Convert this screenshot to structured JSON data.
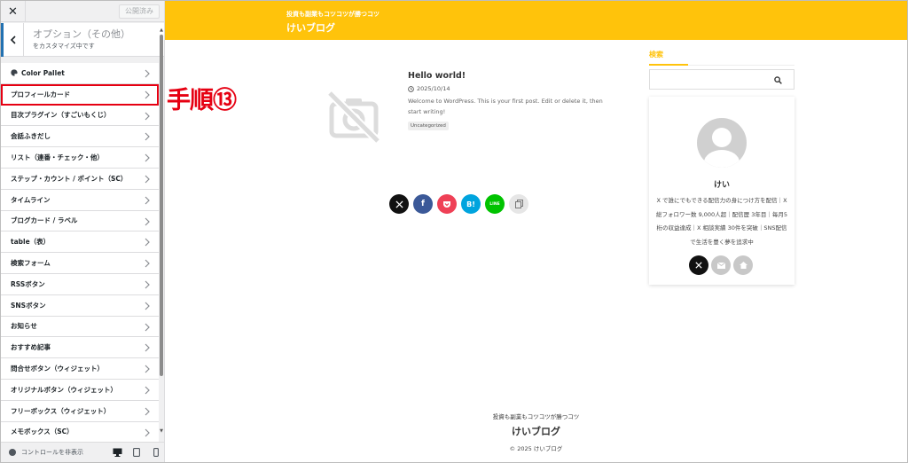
{
  "sidebar": {
    "close_label": "✕",
    "publish_label": "公開済み",
    "header_title": "オプション（その他）",
    "header_sub": "をカスタマイズ中です",
    "items": [
      {
        "label": "Color Pallet"
      },
      {
        "label": "プロフィールカード"
      },
      {
        "label": "目次プラグイン（すごいもくじ）"
      },
      {
        "label": "会話ふきだし"
      },
      {
        "label": "リスト（連番・チェック・他）"
      },
      {
        "label": "ステップ・カウント / ポイント（SC）"
      },
      {
        "label": "タイムライン"
      },
      {
        "label": "ブログカード / ラベル"
      },
      {
        "label": "table（表）"
      },
      {
        "label": "検索フォーム"
      },
      {
        "label": "RSSボタン"
      },
      {
        "label": "SNSボタン"
      },
      {
        "label": "お知らせ"
      },
      {
        "label": "おすすめ記事"
      },
      {
        "label": "問合せボタン（ウィジェット）"
      },
      {
        "label": "オリジナルボタン（ウィジェット）"
      },
      {
        "label": "フリーボックス（ウィジェット）"
      },
      {
        "label": "メモボックス（SC）"
      }
    ],
    "footer_hide_label": "コントロールを非表示"
  },
  "annotation": "手順⑬",
  "preview": {
    "header_tagline": "投資も副業もコツコツが勝つコツ",
    "header_title": "けいブログ",
    "post": {
      "title": "Hello world!",
      "date": "2025/10/14",
      "excerpt": "Welcome to WordPress. This is your first post. Edit or delete it, then start writing!",
      "category": "Uncategorized"
    },
    "share_buttons": [
      "X",
      "f",
      "",
      "B!",
      "LINE",
      ""
    ],
    "search_widget": {
      "title": "検索",
      "placeholder": ""
    },
    "profile": {
      "name": "けい",
      "description": "X で誰にでもできる配信力の身につけ方を配信｜X 総フォロワー数 9,000人超｜配信歴 3年目｜毎月5桁の収益達成｜X 相談実績 30件を突破｜SNS配信で生活を豊く夢を追求中"
    },
    "footer": {
      "tagline": "投資も副業もコツコツが勝つコツ",
      "title": "けいブログ",
      "copyright": "© 2025 けいブログ"
    }
  },
  "colors": {
    "accent": "#ffc30b",
    "highlight": "#e60012",
    "x": "#111111",
    "facebook": "#3b5998",
    "pocket": "#ef4056",
    "hatena": "#00a4de",
    "line": "#00c300",
    "copy": "#e6e6e6"
  }
}
